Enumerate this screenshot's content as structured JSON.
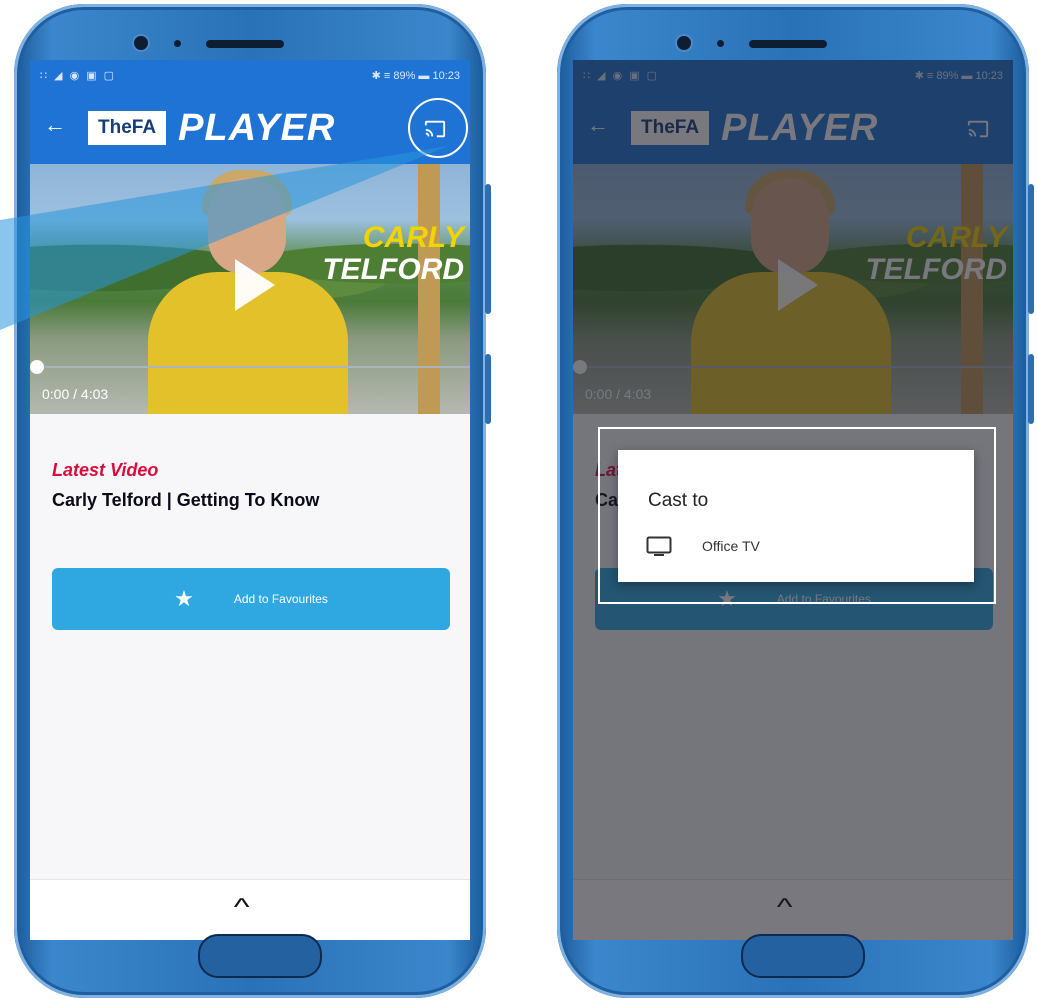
{
  "statusbar": {
    "left_icons": "∷ ◢ ◉ ▣ ▢",
    "right_text": "✱ ≡ 89% ▬ 10:23"
  },
  "appbar": {
    "back_icon": "←",
    "logo_box": "TheFA",
    "logo_text": "PLAYER"
  },
  "video": {
    "name_line1": "CARLY",
    "name_line2": "TELFORD",
    "timecode": "0:00  /  4:03",
    "progress": 0
  },
  "content": {
    "latest_label": "Latest Video",
    "title": "Carly Telford | Getting To Know",
    "favourite_star": "★",
    "favourite_label": "Add to Favourites"
  },
  "bottom": {
    "chevron": "^"
  },
  "cast_dialog": {
    "title": "Cast to",
    "devices": [
      "Office TV"
    ]
  },
  "icons": {
    "back": "arrow-left-icon",
    "cast": "cast-icon",
    "play": "play-icon",
    "star": "star-icon",
    "chevron": "chevron-up-icon",
    "tv": "tv-icon"
  },
  "colors": {
    "appbar": "#1f73d4",
    "accent_red": "#d90d3c",
    "favourite_button": "#2fa8e1",
    "phone_frame": "#2a72b8"
  }
}
